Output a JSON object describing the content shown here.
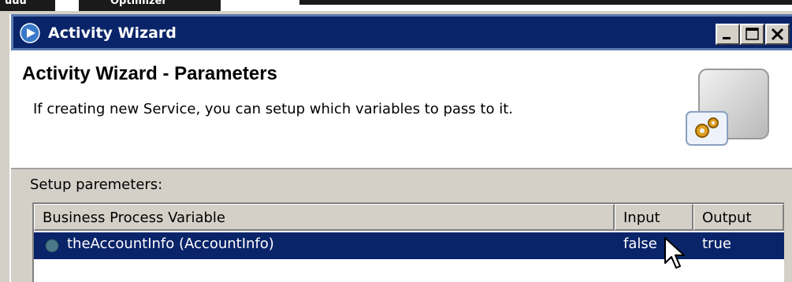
{
  "background": {
    "fragments": [
      "uuu",
      "Optimizer"
    ]
  },
  "window": {
    "title": "Activity Wizard",
    "title_icon": "play-circle-icon",
    "controls": [
      "minimize-icon",
      "maximize-icon",
      "close-icon"
    ]
  },
  "header": {
    "title": "Activity Wizard - Parameters",
    "description": "If creating new Service, you can setup which variables to pass to it.",
    "image_icon": "gears-icon"
  },
  "section_label": "Setup paremeters:",
  "table": {
    "columns": [
      "Business Process Variable",
      "Input",
      "Output"
    ],
    "rows": [
      {
        "variable": "theAccountInfo (AccountInfo)",
        "input": "false",
        "output": "true",
        "selected": true
      }
    ]
  },
  "colors": {
    "titlebar": "#0a246a",
    "selection": "#0a246a",
    "face": "#d4d0c8"
  }
}
